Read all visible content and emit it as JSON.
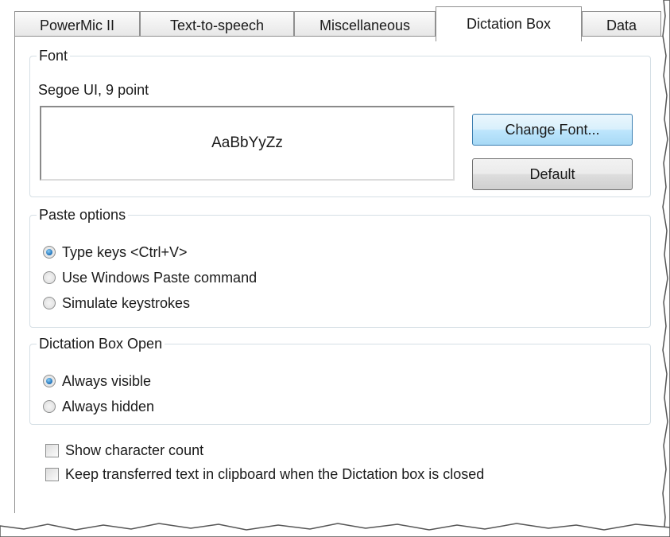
{
  "tabs": [
    {
      "label": "PowerMic II",
      "active": false
    },
    {
      "label": "Text-to-speech",
      "active": false
    },
    {
      "label": "Miscellaneous",
      "active": false
    },
    {
      "label": "Dictation Box",
      "active": true
    },
    {
      "label": "Data",
      "active": false
    }
  ],
  "font_group": {
    "legend": "Font",
    "font_name": "Segoe UI, 9 point",
    "preview_text": "AaBbYyZz",
    "change_font_label": "Change Font...",
    "default_label": "Default"
  },
  "paste_group": {
    "legend": "Paste options",
    "options": [
      {
        "label": "Type keys <Ctrl+V>",
        "checked": true
      },
      {
        "label": "Use Windows Paste command",
        "checked": false
      },
      {
        "label": "Simulate keystrokes",
        "checked": false
      }
    ]
  },
  "open_group": {
    "legend": "Dictation Box Open",
    "options": [
      {
        "label": "Always visible",
        "checked": true
      },
      {
        "label": "Always hidden",
        "checked": false
      }
    ]
  },
  "checkboxes": [
    {
      "label": "Show character count",
      "checked": false
    },
    {
      "label": "Keep transferred text in clipboard when the Dictation box is closed",
      "checked": false
    }
  ],
  "colors": {
    "accent": "#1b6fb8",
    "group_border": "#d5dfe5",
    "button_focus": "#3c7fb1"
  }
}
